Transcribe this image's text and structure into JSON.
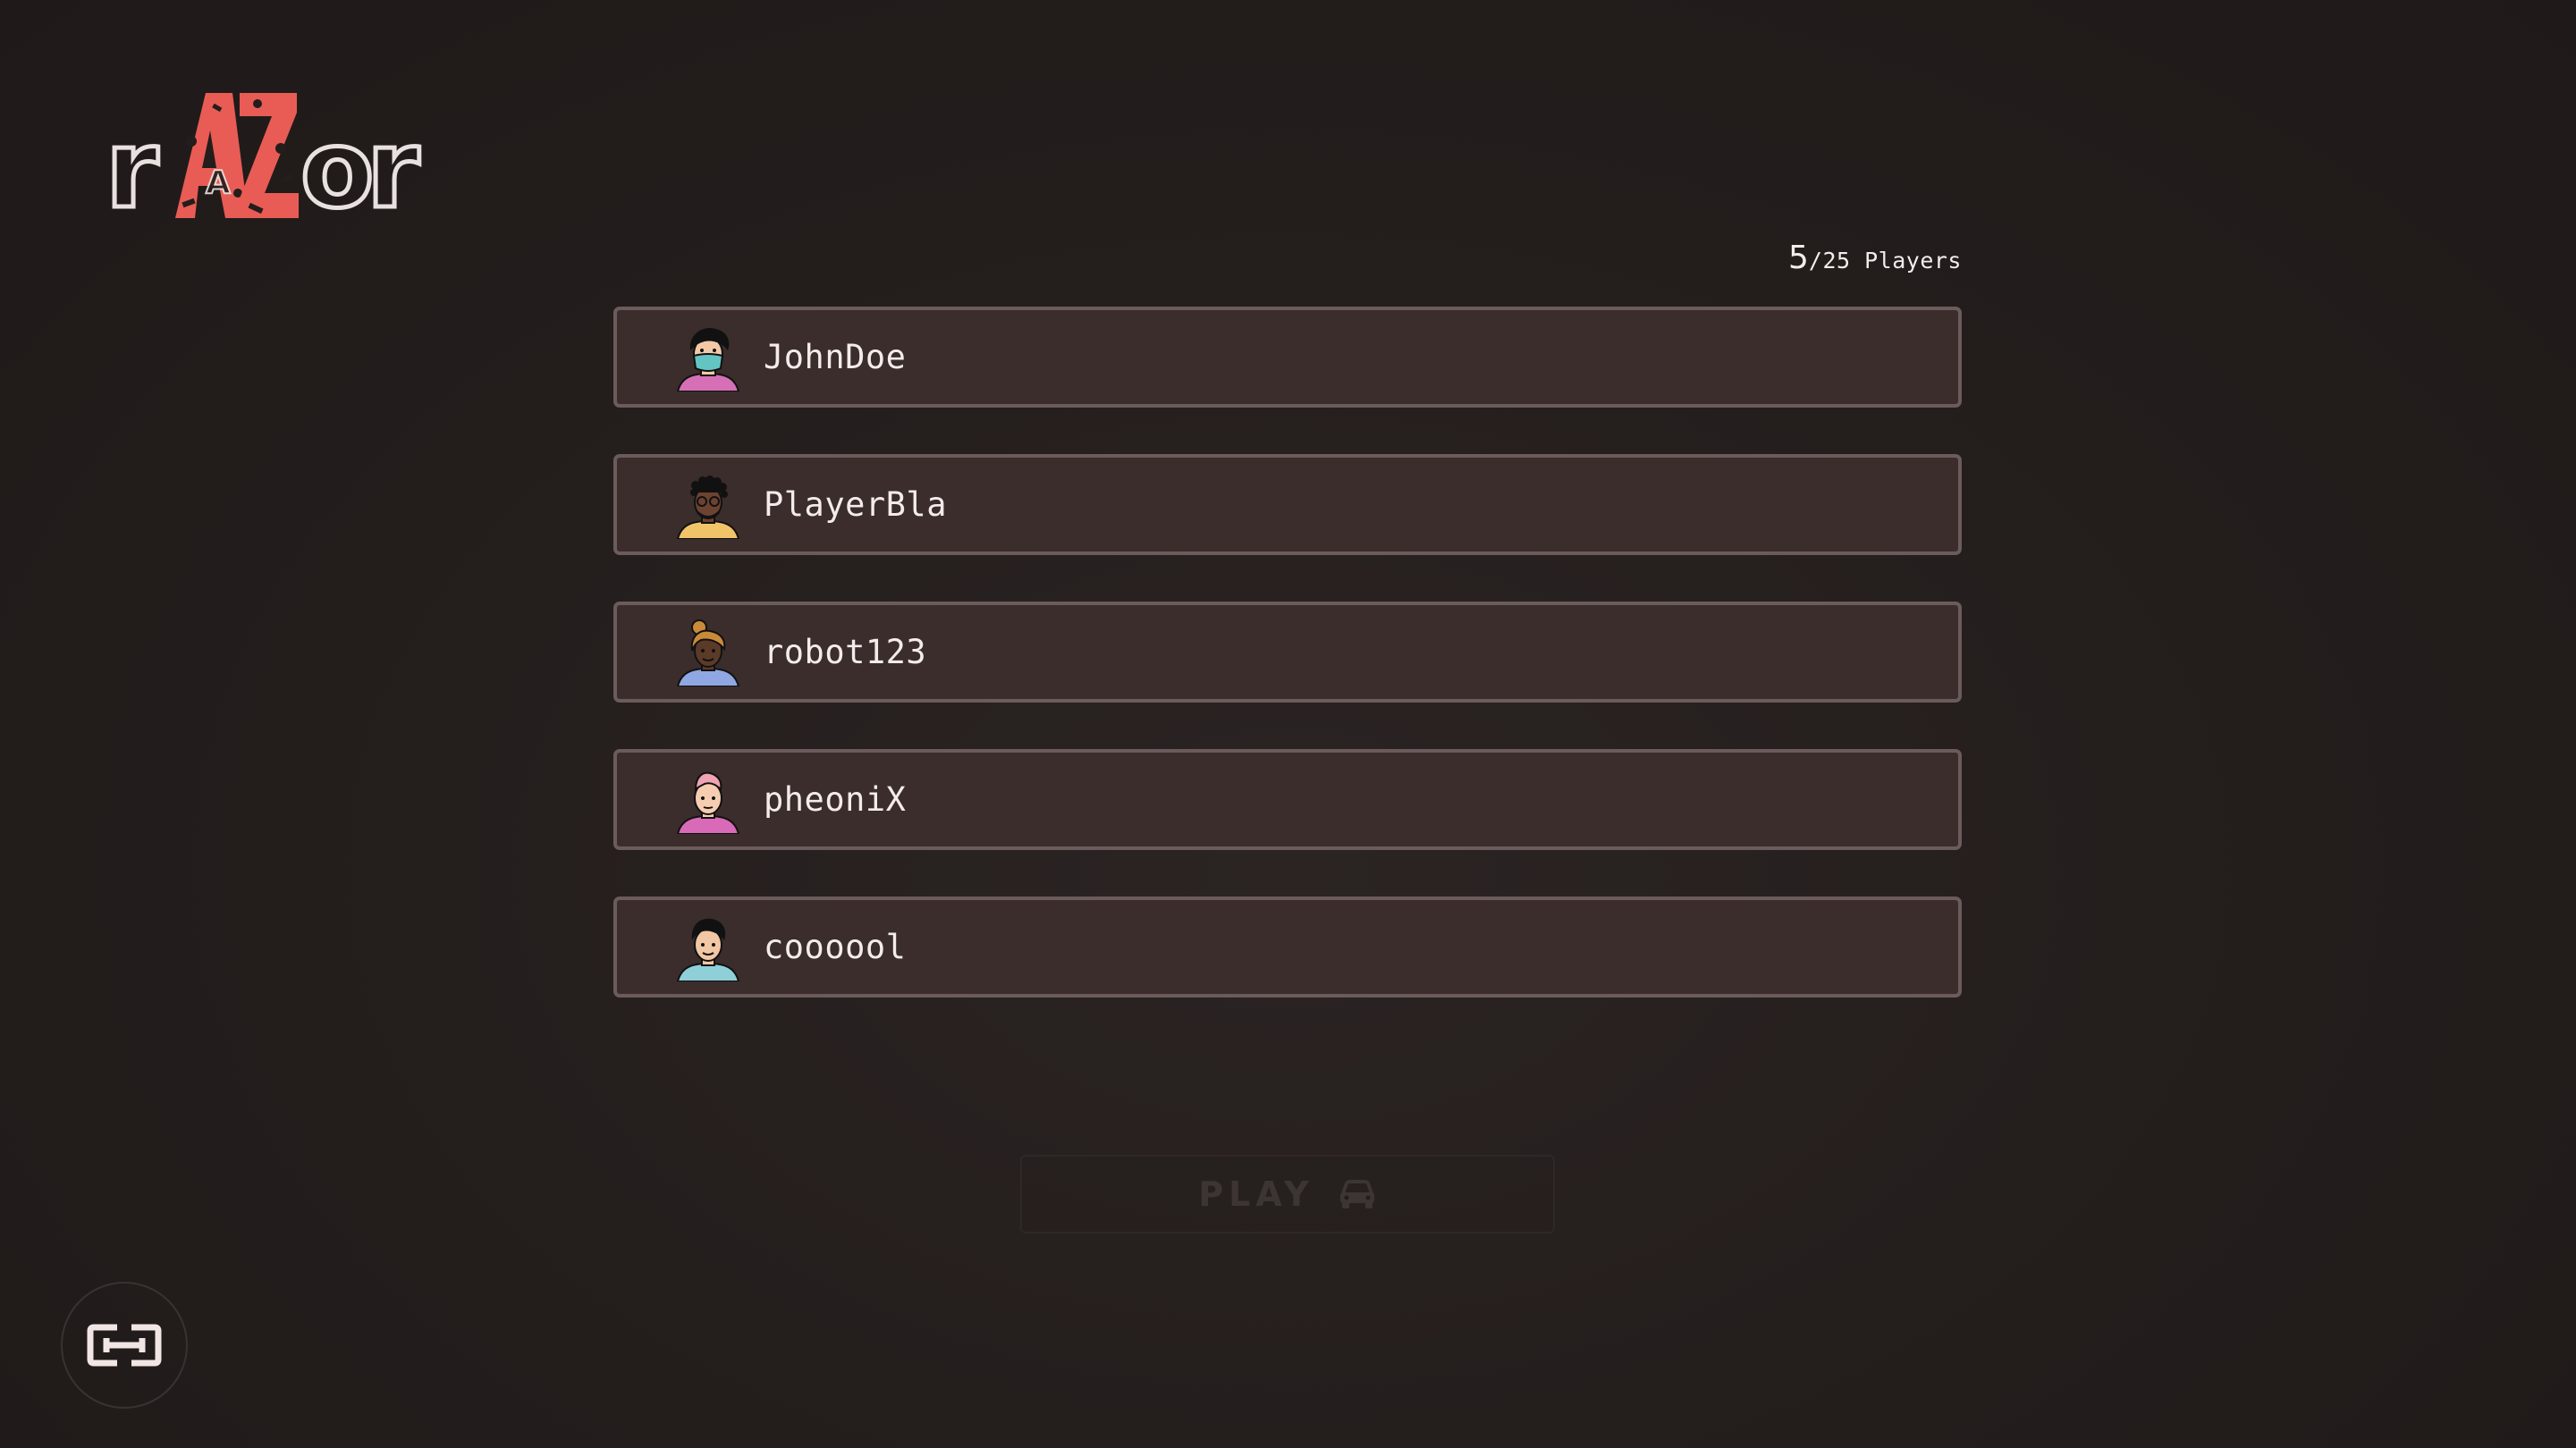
{
  "app": {
    "logo_text": "rAZor"
  },
  "lobby": {
    "player_count": {
      "current": "5",
      "rest": "/25 Players"
    },
    "players": [
      {
        "name": "JohnDoe",
        "avatar": "masked-woman-avatar-icon"
      },
      {
        "name": "PlayerBla",
        "avatar": "dreadlocks-man-avatar-icon"
      },
      {
        "name": "robot123",
        "avatar": "bun-woman-avatar-icon"
      },
      {
        "name": "pheoniX",
        "avatar": "pink-hair-avatar-icon"
      },
      {
        "name": "coooool",
        "avatar": "dark-hair-boy-avatar-icon"
      }
    ]
  },
  "actions": {
    "play_label": "PLAY",
    "play_icon": "car-icon",
    "share_icon": "link-icon"
  },
  "colors": {
    "accent": "#e85c55",
    "background": "#231d1c",
    "row_fill": "#3a2d2c",
    "row_border": "#6b5c5b"
  }
}
